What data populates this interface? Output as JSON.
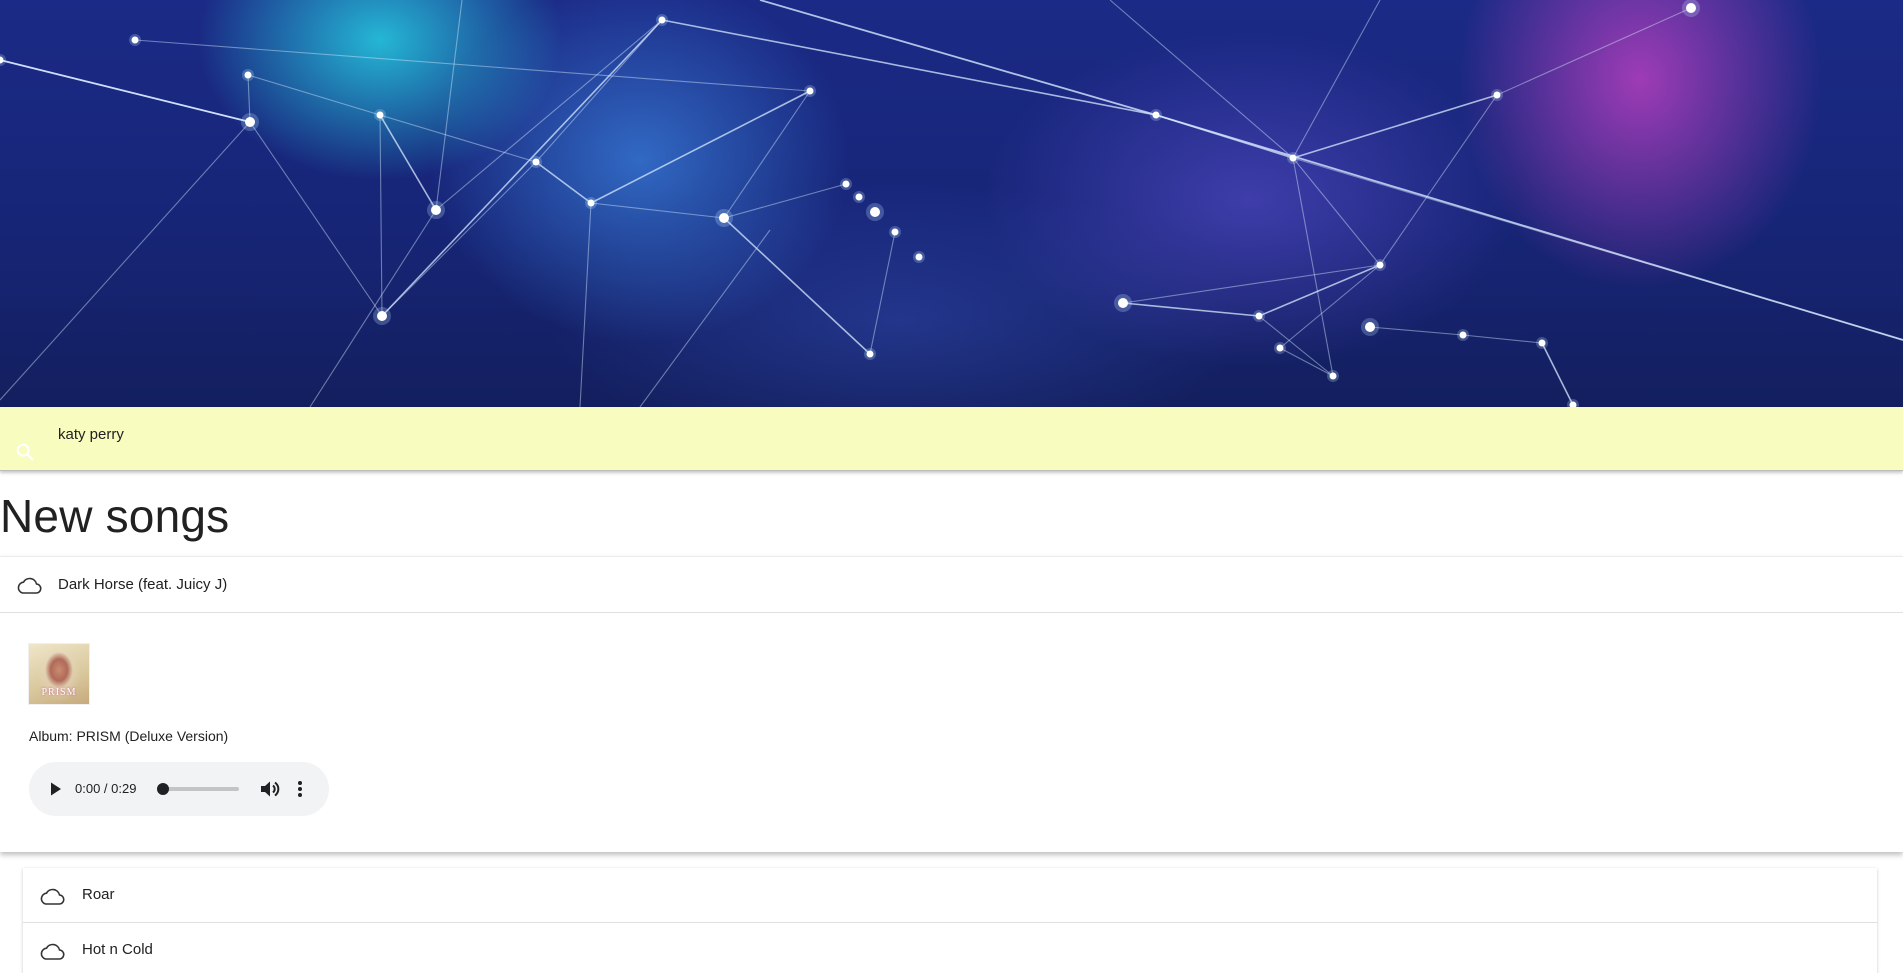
{
  "search": {
    "query": "katy perry",
    "icon": "search-icon"
  },
  "section": {
    "title": "New songs"
  },
  "expanded_song": {
    "title": "Dark Horse (feat. Juicy J)",
    "icon": "cloud-icon",
    "album_art_text": "PRISM",
    "album_label": "Album: PRISM (Deluxe Version)",
    "player": {
      "time": "0:00 / 0:29",
      "progress": 0
    }
  },
  "songs": [
    {
      "title": "Roar",
      "icon": "cloud-icon"
    },
    {
      "title": "Hot n Cold",
      "icon": "cloud-icon"
    }
  ],
  "colors": {
    "search_bar_bg": "#f8fcbe",
    "player_bg": "#f1f3f4",
    "banner_dark": "#172577",
    "banner_cyan": "#28e6f0",
    "banner_magenta": "#e646d2"
  }
}
